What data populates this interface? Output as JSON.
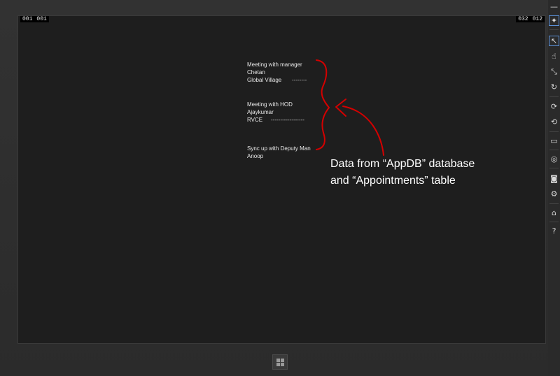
{
  "screen": {
    "counters_left": [
      "001",
      "001"
    ],
    "counters_right": [
      "032",
      "012"
    ]
  },
  "appointments": [
    {
      "title": "Meeting with manager",
      "person": "Chetan",
      "place": "Global Village",
      "dashes": "--------"
    },
    {
      "title": "Meeting with HOD",
      "person": "Ajaykumar",
      "place": "RVCE",
      "dashes": "------------------"
    },
    {
      "title": "Sync up with Deputy Man",
      "person": "Anoop",
      "place": "",
      "dashes": ""
    }
  ],
  "annotation": {
    "line1": "Data from “AppDB” database",
    "line2": "and “Appointments” table",
    "color": "#d40000"
  },
  "toolbar": {
    "items": [
      {
        "name": "minimize-icon",
        "glyph": "—"
      },
      {
        "name": "pin-icon",
        "glyph": "✦"
      },
      {
        "name": "mouse-pointer-icon",
        "glyph": "↖"
      },
      {
        "name": "touch-icon",
        "glyph": "☝"
      },
      {
        "name": "pinch-zoom-icon",
        "glyph": "⤡"
      },
      {
        "name": "rotation-touch-icon",
        "glyph": "↻"
      },
      {
        "name": "rotate-clockwise-icon",
        "glyph": "⟳"
      },
      {
        "name": "rotate-counterclockwise-icon",
        "glyph": "⟲"
      },
      {
        "name": "change-resolution-icon",
        "glyph": "▭"
      },
      {
        "name": "set-location-icon",
        "glyph": "◎"
      },
      {
        "name": "screenshot-icon",
        "glyph": "◙"
      },
      {
        "name": "screenshot-settings-icon",
        "glyph": "⚙"
      },
      {
        "name": "network-icon",
        "glyph": "⌂"
      },
      {
        "name": "help-icon",
        "glyph": "?"
      }
    ]
  }
}
